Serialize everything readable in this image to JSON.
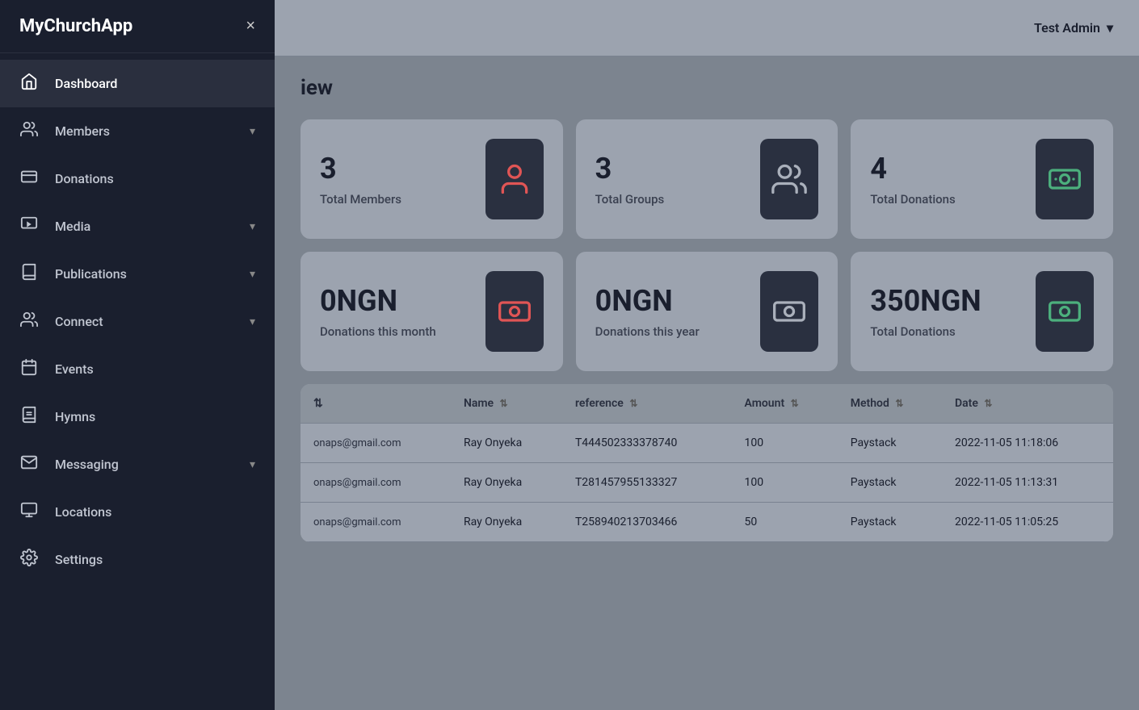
{
  "app": {
    "title": "MyChurchApp",
    "close_label": "×"
  },
  "header": {
    "page_title": "iew",
    "user": "Test Admin",
    "user_chevron": "▾"
  },
  "sidebar": {
    "items": [
      {
        "id": "dashboard",
        "label": "Dashboard",
        "icon": "home",
        "has_chevron": false,
        "active": true
      },
      {
        "id": "members",
        "label": "Members",
        "icon": "members",
        "has_chevron": true
      },
      {
        "id": "donations",
        "label": "Donations",
        "icon": "donations",
        "has_chevron": false
      },
      {
        "id": "media",
        "label": "Media",
        "icon": "media",
        "has_chevron": true
      },
      {
        "id": "publications",
        "label": "Publications",
        "icon": "publications",
        "has_chevron": true
      },
      {
        "id": "connect",
        "label": "Connect",
        "icon": "connect",
        "has_chevron": true
      },
      {
        "id": "events",
        "label": "Events",
        "icon": "events",
        "has_chevron": false
      },
      {
        "id": "hymns",
        "label": "Hymns",
        "icon": "hymns",
        "has_chevron": false
      },
      {
        "id": "messaging",
        "label": "Messaging",
        "icon": "messaging",
        "has_chevron": true
      },
      {
        "id": "locations",
        "label": "Locations",
        "icon": "locations",
        "has_chevron": false
      },
      {
        "id": "settings",
        "label": "Settings",
        "icon": "settings",
        "has_chevron": false
      }
    ]
  },
  "stats_row1": [
    {
      "id": "total-members",
      "number": "3",
      "label": "Total Members",
      "icon_color": "#e05555",
      "icon_type": "person"
    },
    {
      "id": "total-groups",
      "number": "3",
      "label": "Total Groups",
      "icon_color": "#aab0bb",
      "icon_type": "group"
    },
    {
      "id": "total-donations",
      "number": "4",
      "label": "Total Donations",
      "icon_color": "#4caf7d",
      "icon_type": "money"
    }
  ],
  "stats_row2": [
    {
      "id": "donations-month",
      "number": "0NGN",
      "label": "Donations this month",
      "icon_color": "#e05555",
      "icon_type": "money"
    },
    {
      "id": "donations-year",
      "number": "0NGN",
      "label": "Donations this year",
      "icon_color": "#aab0bb",
      "icon_type": "money"
    },
    {
      "id": "total-donations-ngn",
      "number": "350NGN",
      "label": "Total Donations",
      "icon_color": "#4caf7d",
      "icon_type": "money"
    }
  ],
  "table": {
    "columns": [
      {
        "id": "email",
        "label": ""
      },
      {
        "id": "name",
        "label": "Name"
      },
      {
        "id": "reference",
        "label": "reference"
      },
      {
        "id": "amount",
        "label": "Amount"
      },
      {
        "id": "method",
        "label": "Method"
      },
      {
        "id": "date",
        "label": "Date"
      }
    ],
    "rows": [
      {
        "email": "onaps@gmail.com",
        "name": "Ray Onyeka",
        "reference": "T44450233337874​0",
        "amount": "100",
        "method": "Paystack",
        "date": "2022-11-05 11:18:06"
      },
      {
        "email": "onaps@gmail.com",
        "name": "Ray Onyeka",
        "reference": "T281457955133327",
        "amount": "100",
        "method": "Paystack",
        "date": "2022-11-05 11:13:31"
      },
      {
        "email": "onaps@gmail.com",
        "name": "Ray Onyeka",
        "reference": "T258940213703466",
        "amount": "50",
        "method": "Paystack",
        "date": "2022-11-05 11:05:25"
      }
    ]
  }
}
